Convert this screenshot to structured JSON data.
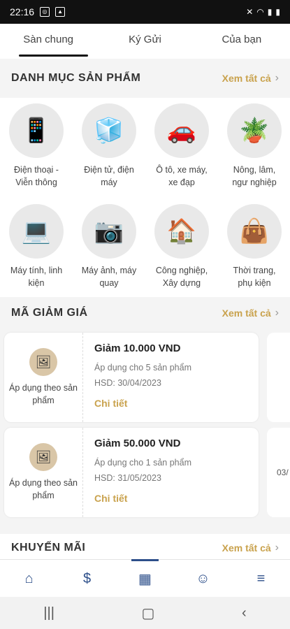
{
  "status_bar": {
    "time": "22:16"
  },
  "tabs": [
    "Sàn chung",
    "Ký Gửi",
    "Của bạn"
  ],
  "categories_section": {
    "title": "DANH MỤC SẢN PHẨM",
    "see_all": "Xem tất cả"
  },
  "categories": [
    {
      "line1": "Điện thoại -",
      "line2": "Viễn thông",
      "icon": "phone-icon"
    },
    {
      "line1": "Điện tử, điện",
      "line2": "máy",
      "icon": "air-conditioner-icon"
    },
    {
      "line1": "Ô tô, xe máy,",
      "line2": "xe đạp",
      "icon": "car-icon"
    },
    {
      "line1": "Nông, lâm,",
      "line2": "ngư nghiệp",
      "icon": "plant-icon"
    },
    {
      "line1": "Máy tính, linh",
      "line2": "kiện",
      "icon": "laptop-icon"
    },
    {
      "line1": "Máy ảnh, máy",
      "line2": "quay",
      "icon": "camera-icon"
    },
    {
      "line1": "Công nghiệp,",
      "line2": "Xây dựng",
      "icon": "house-icon"
    },
    {
      "line1": "Thời trang,",
      "line2": "phụ kiện",
      "icon": "fashion-icon"
    }
  ],
  "vouchers_section": {
    "title": "MÃ GIẢM GIÁ",
    "see_all": "Xem tất cả"
  },
  "vouchers": [
    {
      "apply_to": "Áp dụng theo sản phẩm",
      "amount": "Giảm 10.000 VND",
      "scope": "Áp dụng cho 5 sản phẩm",
      "expiry": "HSD: 30/04/2023",
      "detail": "Chi tiết"
    },
    {
      "apply_to": "Áp dụng theo sản phẩm",
      "amount": "Giảm 50.000 VND",
      "scope": "Áp dụng cho 1 sản phẩm",
      "expiry": "HSD: 31/05/2023",
      "detail": "Chi tiết"
    }
  ],
  "voucher_peek": "03/",
  "promotions_section": {
    "title": "KHUYẾN MÃI",
    "see_all": "Xem tất cả"
  },
  "bottom_nav": [
    "home-icon",
    "coin-icon",
    "store-icon",
    "people-icon",
    "menu-icon"
  ]
}
